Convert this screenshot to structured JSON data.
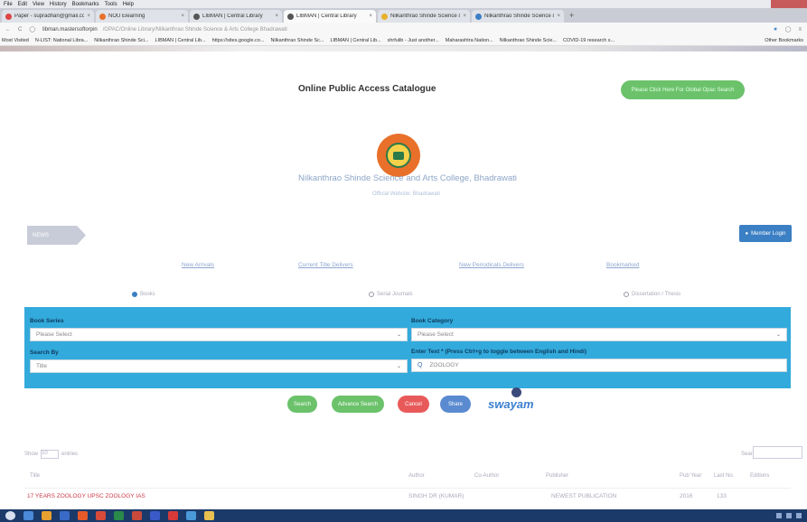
{
  "browser": {
    "menu": [
      "File",
      "Edit",
      "View",
      "History",
      "Bookmarks",
      "Tools",
      "Help"
    ],
    "tabs": [
      {
        "label": "Paper - supradhan@gmail.com",
        "active": false
      },
      {
        "label": "NOU Elearning",
        "active": false
      },
      {
        "label": "LIBMAN | Central Library",
        "active": false
      },
      {
        "label": "LIBMAN | Central Library",
        "active": true
      },
      {
        "label": "Nilkanthrao Shinde Science & A",
        "active": false
      },
      {
        "label": "Nilkanthrao Shinde Science & A",
        "active": false
      }
    ],
    "url_host": "libman.mastersoftorpin",
    "url_rest": "/OPAC/Online Library/Nilkanthrao Shinde Science & Arts College Bhadrawati",
    "bookmarks": [
      "Most Visited",
      "N-LIST: National Libra...",
      "Nilkanthrao Shinde Sci...",
      "LIBMAN | Central Lib...",
      "https://sites.google.co...",
      "Nilkanthrao Shinde Sc...",
      "LIBMAN | Central Lib...",
      "shrfulib - Just another...",
      "Maharashtra Nation...",
      "Nilkanthrao Shinde Scie...",
      "COVID-19 research s..."
    ],
    "other_bookmarks": "Other Bookmarks"
  },
  "header": {
    "title": "Online Public Access Catalogue",
    "global_search_label": "Please Click Here For Global Opac Search",
    "college_name": "Nilkanthrao Shinde Science and Arts College, Bhadrawati",
    "college_sub": "Official Website: Bhadrawati",
    "news_label": "NEWS",
    "member_login_label": "Member Login"
  },
  "links": [
    "New Arrivals",
    "Current Title Delivers",
    "New Periodicals Delivers",
    "Bookmarked"
  ],
  "search_type": {
    "options": [
      "Books",
      "Serial Journals",
      "Dissertation / Thesis"
    ],
    "selected": "Books"
  },
  "search_form": {
    "book_series_label": "Book Series",
    "book_series_value": "Please Select",
    "book_category_label": "Book Category",
    "book_category_value": "Please Select",
    "search_by_label": "Search By",
    "search_by_value": "Title",
    "enter_text_label": "Enter Text * (Press Ctrl+g to toggle between English and Hindi)",
    "enter_text_value": "ZOOLOGY"
  },
  "buttons": {
    "search": "Search",
    "advance_search": "Advance Search",
    "cancel": "Cancel",
    "share": "Share",
    "swayam": "swayam"
  },
  "colors": {
    "green": "#6bc26b",
    "red": "#e85a5a",
    "blue": "#3b7fc4",
    "panel": "#33aadc"
  },
  "table": {
    "show_label": "Show",
    "show_value": "10",
    "entries_label": "entries",
    "search_label": "Search:",
    "headers": [
      "Title",
      "Author",
      "Co-Author",
      "Publisher",
      "Pub Year",
      "Last No.",
      "Editions"
    ],
    "rows": [
      [
        "17 YEARS ZOOLOGY UPSC ZOOLOGY IAS",
        "SINGH DR (KUMAR)",
        "",
        "NEWEST PUBLICATION",
        "2016",
        "133",
        ""
      ]
    ]
  }
}
